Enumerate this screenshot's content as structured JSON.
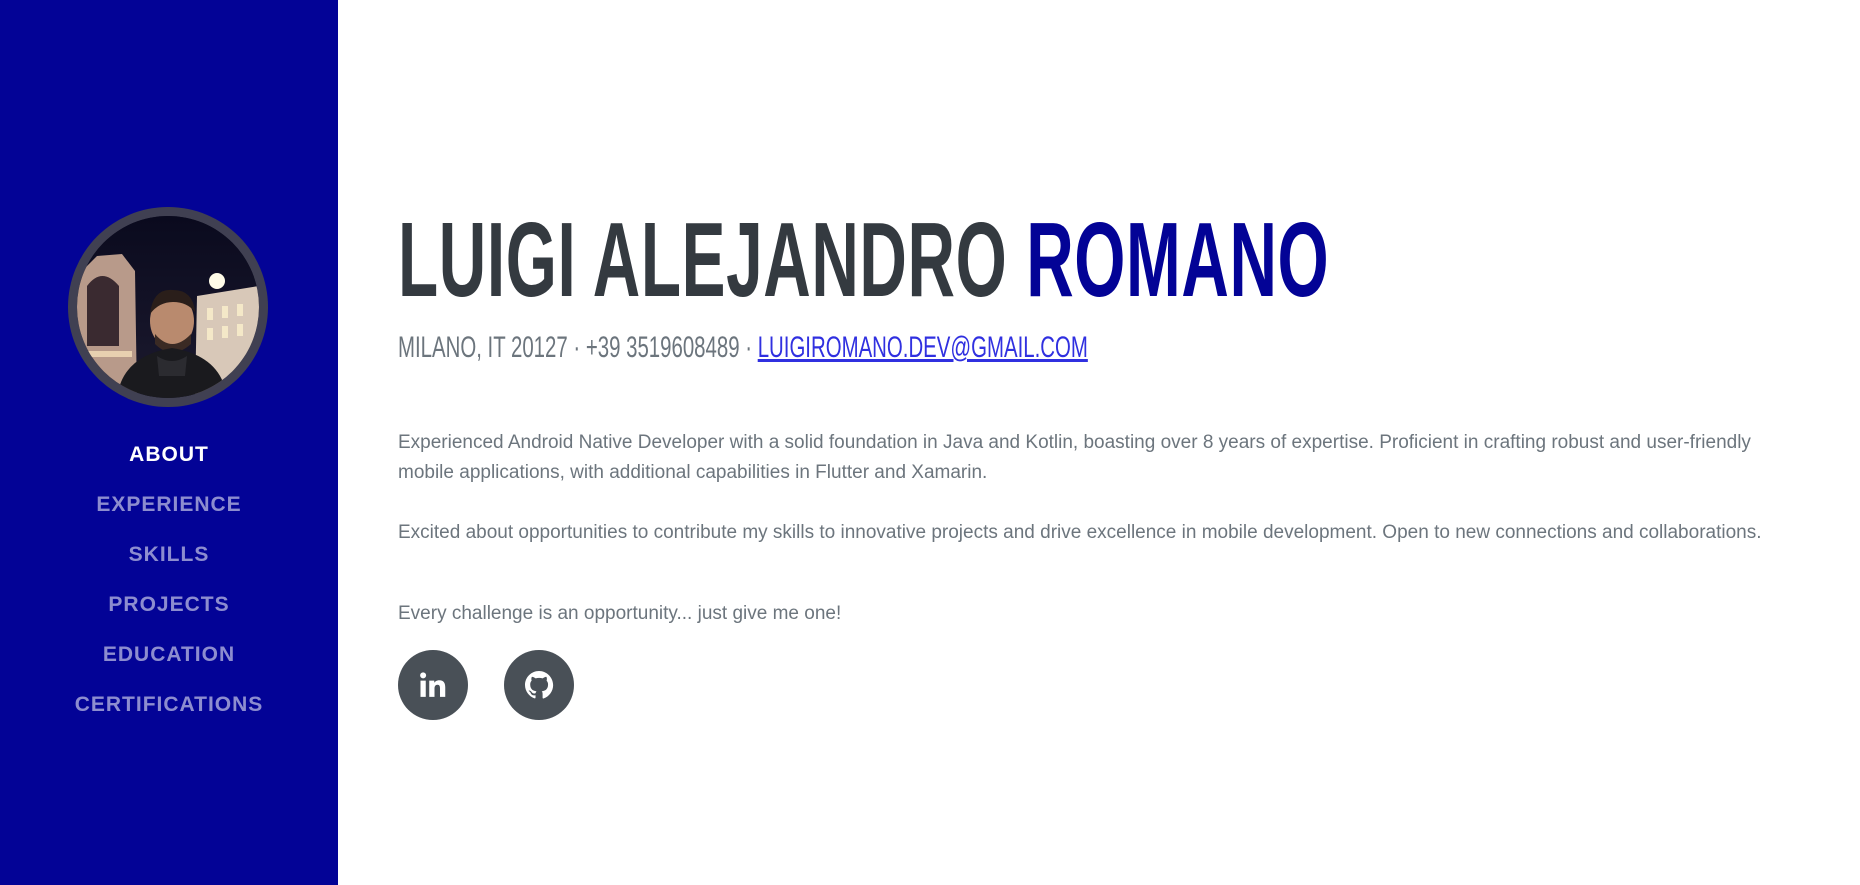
{
  "profile": {
    "avatar_alt": "profile photo"
  },
  "nav": {
    "items": [
      {
        "label": "ABOUT"
      },
      {
        "label": "EXPERIENCE"
      },
      {
        "label": "SKILLS"
      },
      {
        "label": "PROJECTS"
      },
      {
        "label": "EDUCATION"
      },
      {
        "label": "CERTIFICATIONS"
      }
    ],
    "active": "ABOUT"
  },
  "header": {
    "first_name": "LUIGI ALEJANDRO",
    "last_name": "ROMANO",
    "location_phone": "MILANO, IT 20127 · +39 3519608489 · ",
    "email": "LUIGIROMANO.DEV@GMAIL.COM"
  },
  "about": {
    "paragraph_1": "Experienced Android Native Developer with a solid foundation in Java and Kotlin, boasting over 8 years of expertise. Proficient in crafting robust and user-friendly mobile applications, with additional capabilities in Flutter and Xamarin.",
    "paragraph_2": "Excited about opportunities to contribute my skills to innovative projects and drive excellence in mobile development. Open to new connections and collaborations.",
    "paragraph_3": "Every challenge is an opportunity... just give me one!"
  },
  "social": {
    "icons": [
      "linkedin-icon",
      "github-icon"
    ]
  },
  "colors": {
    "sidebar_bg": "#030396",
    "accent": "#030396",
    "heading": "#343a40",
    "body_text": "#6c757d",
    "link": "#3030e0",
    "social_bg": "#495057"
  }
}
